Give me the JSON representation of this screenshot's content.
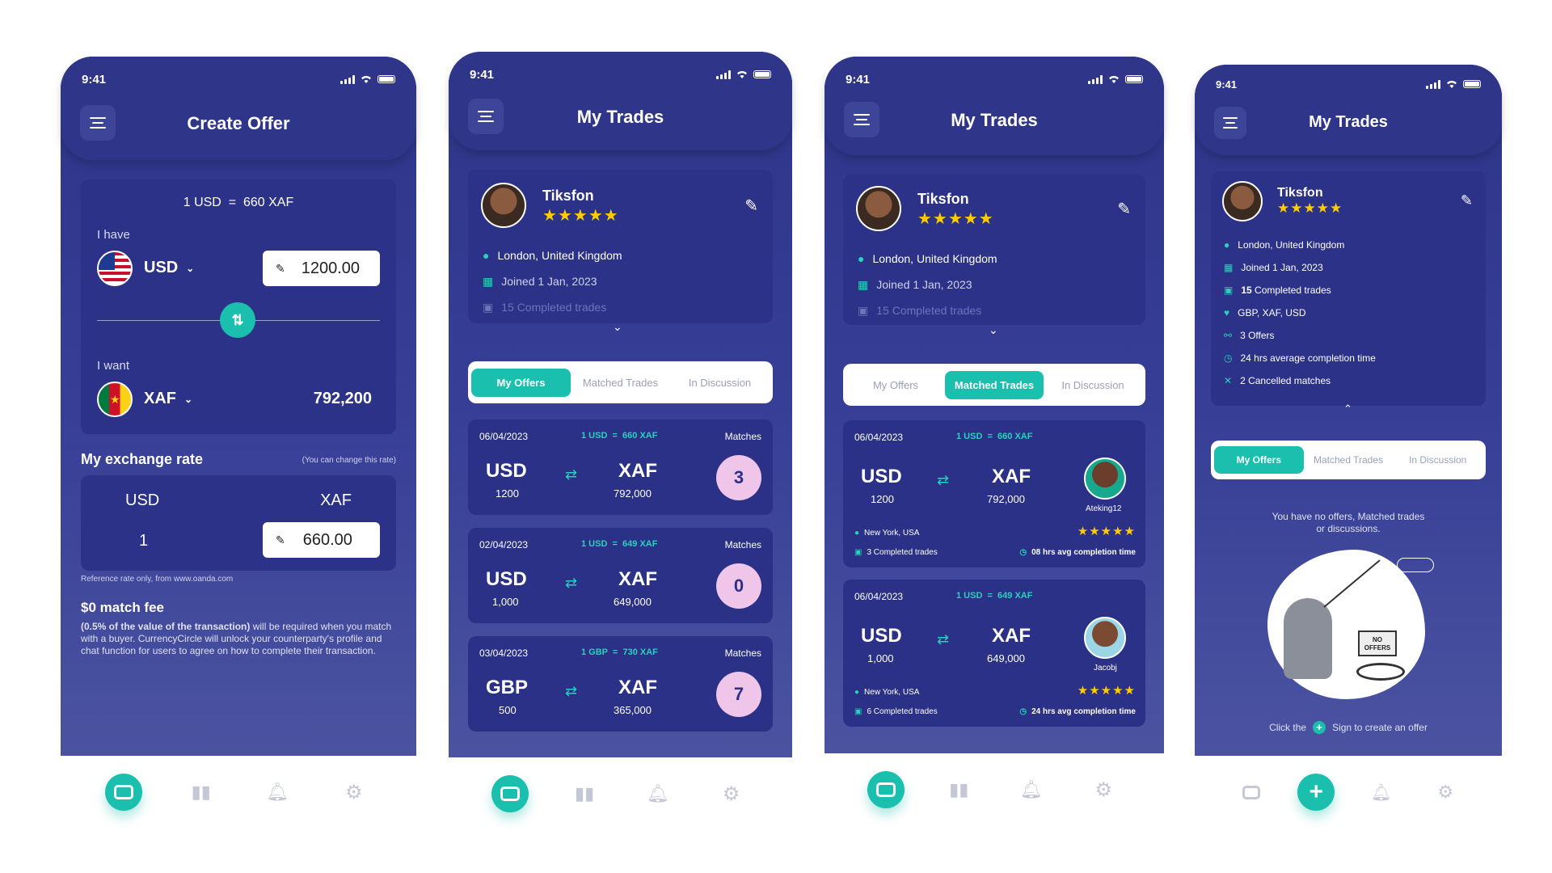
{
  "colors": {
    "primary": "#2e3589",
    "accent": "#1bbfae",
    "badge": "#efc5ea",
    "star": "#ffcc00"
  },
  "status_time": "9:41",
  "screen1": {
    "title": "Create Offer",
    "rate_line": "1 USD  =  660 XAF",
    "i_have": "I have",
    "have_currency": "USD",
    "have_amount": "1200.00",
    "i_want": "I want",
    "want_currency": "XAF",
    "want_amount": "792,200",
    "my_rate_title": "My exchange rate",
    "my_rate_note": "(You can change this rate)",
    "rate_from": "USD",
    "rate_to": "XAF",
    "rate_from_value": "1",
    "rate_to_value": "660.00",
    "reference": "Reference rate only, from www.oanda.com",
    "fee_title": "$0 match fee",
    "fee_bold": "(0.5% of the value of the transaction)",
    "fee_text": " will be required when you match with a buyer. CurrencyCircle will unlock your counterparty's profile and chat function for users to agree on how to complete their transaction."
  },
  "profile": {
    "name": "Tiksfon",
    "stars": "★★★★★",
    "location": "London, United Kingdom",
    "joined": "Joined 1 Jan, 2023",
    "completed_num": "15",
    "completed": "Completed trades",
    "completed_full": "15 Completed trades",
    "currencies": "GBP, XAF, USD",
    "offers": "3 Offers",
    "avg_time": "24 hrs average completion time",
    "cancelled": "2  Cancelled matches"
  },
  "common_title": "My Trades",
  "tabs": [
    "My Offers",
    "Matched Trades",
    "In Discussion"
  ],
  "screen2": {
    "trades": [
      {
        "date": "06/04/2023",
        "rate": "1 USD  =  660 XAF",
        "matches_label": "Matches",
        "from": "USD",
        "from_amt": "1200",
        "to": "XAF",
        "to_amt": "792,000",
        "count": "3"
      },
      {
        "date": "02/04/2023",
        "rate": "1 USD  =  649 XAF",
        "matches_label": "Matches",
        "from": "USD",
        "from_amt": "1,000",
        "to": "XAF",
        "to_amt": "649,000",
        "count": "0"
      },
      {
        "date": "03/04/2023",
        "rate": "1 GBP  =  730 XAF",
        "matches_label": "Matches",
        "from": "GBP",
        "from_amt": "500",
        "to": "XAF",
        "to_amt": "365,000",
        "count": "7"
      }
    ]
  },
  "screen3": {
    "trades": [
      {
        "date": "06/04/2023",
        "rate": "1 USD  =  660 XAF",
        "from": "USD",
        "from_amt": "1200",
        "to": "XAF",
        "to_amt": "792,000",
        "user": "Ateking12",
        "location": "New York, USA",
        "completed": "3 Completed trades",
        "avg": "08 hrs avg completion time",
        "stars": "★★★★★"
      },
      {
        "date": "06/04/2023",
        "rate": "1 USD  =  649 XAF",
        "from": "USD",
        "from_amt": "1,000",
        "to": "XAF",
        "to_amt": "649,000",
        "user": "Jacobj",
        "location": "New York, USA",
        "completed": "6 Completed trades",
        "avg": "24 hrs avg completion time",
        "stars": "★★★★★"
      }
    ]
  },
  "screen4": {
    "empty_msg": "You have no offers, Matched trades or discussions.",
    "sign_label": "NO OFFERS",
    "cta_pre": "Click the",
    "cta_post": "Sign to create an offer"
  }
}
